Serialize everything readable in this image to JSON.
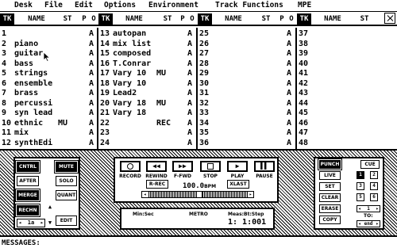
{
  "menu": [
    "Desk",
    "File",
    "Edit",
    "Options",
    "Environment",
    "Track Functions",
    "MPE"
  ],
  "headers": {
    "tk": "TK",
    "name": "NAME",
    "st": "ST",
    "p": "P",
    "o": "O"
  },
  "columns": [
    {
      "rows": [
        {
          "tk": "1",
          "name": "",
          "st": "",
          "p": "A"
        },
        {
          "tk": "2",
          "name": "piano",
          "st": "",
          "p": "A"
        },
        {
          "tk": "3",
          "name": "guitar",
          "st": "",
          "p": "A"
        },
        {
          "tk": "4",
          "name": "bass",
          "st": "",
          "p": "A"
        },
        {
          "tk": "5",
          "name": "strings",
          "st": "",
          "p": "A"
        },
        {
          "tk": "6",
          "name": "ensemble",
          "st": "",
          "p": "A"
        },
        {
          "tk": "7",
          "name": "brass",
          "st": "",
          "p": "A"
        },
        {
          "tk": "8",
          "name": "percussi",
          "st": "",
          "p": "A"
        },
        {
          "tk": "9",
          "name": "syn lead",
          "st": "",
          "p": "A"
        },
        {
          "tk": "10",
          "name": "ethnic",
          "st": "MU",
          "p": "A"
        },
        {
          "tk": "11",
          "name": "mix",
          "st": "",
          "p": "A"
        },
        {
          "tk": "12",
          "name": "synthEdi",
          "st": "",
          "p": "A"
        }
      ]
    },
    {
      "rows": [
        {
          "tk": "13",
          "name": "autopan",
          "st": "",
          "p": "A"
        },
        {
          "tk": "14",
          "name": "mix list",
          "st": "",
          "p": "A"
        },
        {
          "tk": "15",
          "name": "composed",
          "st": "",
          "p": "A"
        },
        {
          "tk": "16",
          "name": "T.Conrar",
          "st": "",
          "p": "A"
        },
        {
          "tk": "17",
          "name": "Vary 10",
          "st": "MU",
          "p": "A"
        },
        {
          "tk": "18",
          "name": "Vary 10",
          "st": "",
          "p": "A"
        },
        {
          "tk": "19",
          "name": "Lead2",
          "st": "",
          "p": "A"
        },
        {
          "tk": "20",
          "name": "Vary 18",
          "st": "MU",
          "p": "A"
        },
        {
          "tk": "21",
          "name": "Vary 18",
          "st": "",
          "p": "A"
        },
        {
          "tk": "22",
          "name": "",
          "st": "REC",
          "p": "A"
        },
        {
          "tk": "23",
          "name": "",
          "st": "",
          "p": "A"
        },
        {
          "tk": "24",
          "name": "",
          "st": "",
          "p": "A"
        }
      ]
    },
    {
      "rows": [
        {
          "tk": "25",
          "name": "",
          "st": "",
          "p": "A"
        },
        {
          "tk": "26",
          "name": "",
          "st": "",
          "p": "A"
        },
        {
          "tk": "27",
          "name": "",
          "st": "",
          "p": "A"
        },
        {
          "tk": "28",
          "name": "",
          "st": "",
          "p": "A"
        },
        {
          "tk": "29",
          "name": "",
          "st": "",
          "p": "A"
        },
        {
          "tk": "30",
          "name": "",
          "st": "",
          "p": "A"
        },
        {
          "tk": "31",
          "name": "",
          "st": "",
          "p": "A"
        },
        {
          "tk": "32",
          "name": "",
          "st": "",
          "p": "A"
        },
        {
          "tk": "33",
          "name": "",
          "st": "",
          "p": "A"
        },
        {
          "tk": "34",
          "name": "",
          "st": "",
          "p": "A"
        },
        {
          "tk": "35",
          "name": "",
          "st": "",
          "p": "A"
        },
        {
          "tk": "36",
          "name": "",
          "st": "",
          "p": "A"
        }
      ]
    },
    {
      "rows": [
        {
          "tk": "37",
          "name": "",
          "st": "",
          "p": ""
        },
        {
          "tk": "38",
          "name": "",
          "st": "",
          "p": ""
        },
        {
          "tk": "39",
          "name": "",
          "st": "",
          "p": ""
        },
        {
          "tk": "40",
          "name": "",
          "st": "",
          "p": ""
        },
        {
          "tk": "41",
          "name": "",
          "st": "",
          "p": ""
        },
        {
          "tk": "42",
          "name": "",
          "st": "",
          "p": ""
        },
        {
          "tk": "43",
          "name": "",
          "st": "",
          "p": ""
        },
        {
          "tk": "44",
          "name": "",
          "st": "",
          "p": ""
        },
        {
          "tk": "45",
          "name": "",
          "st": "",
          "p": ""
        },
        {
          "tk": "46",
          "name": "",
          "st": "",
          "p": ""
        },
        {
          "tk": "47",
          "name": "",
          "st": "",
          "p": ""
        },
        {
          "tk": "48",
          "name": "",
          "st": "",
          "p": ""
        }
      ]
    }
  ],
  "left_panel": {
    "cntrl": "CNTRL",
    "after": "AFTER",
    "merge": "MERGE",
    "rechn": "RECHN",
    "mute": "MUTE",
    "solo": "SOLO",
    "quant": "QUANT",
    "edit": "EDIT",
    "channel": "1a"
  },
  "transport": {
    "record": "RECORD",
    "rewind": "REWIND",
    "ffwd": "F-FWD",
    "stop": "STOP",
    "play": "PLAY",
    "pause": "PAUSE",
    "rrec": "R-REC",
    "tempo": "100.0",
    "bpm": "BPM",
    "xlast": "XLAST"
  },
  "counter": {
    "minsec": "Min:Sec",
    "metro": "METRO",
    "measlabel": "Meas:Bt:Step",
    "measvalue": "1: 1:001"
  },
  "right_panel": {
    "punch": "PUNCH",
    "live": "LIVE",
    "set": "SET",
    "clear": "CLEAR",
    "erase": "ERASE",
    "copy": "COPY",
    "cue": "CUE",
    "cue_num": "1",
    "to": "TO:",
    "end": "end",
    "tracks": [
      "1",
      "2",
      "3",
      "4",
      "5",
      "6"
    ]
  },
  "messages": "MESSAGES:"
}
